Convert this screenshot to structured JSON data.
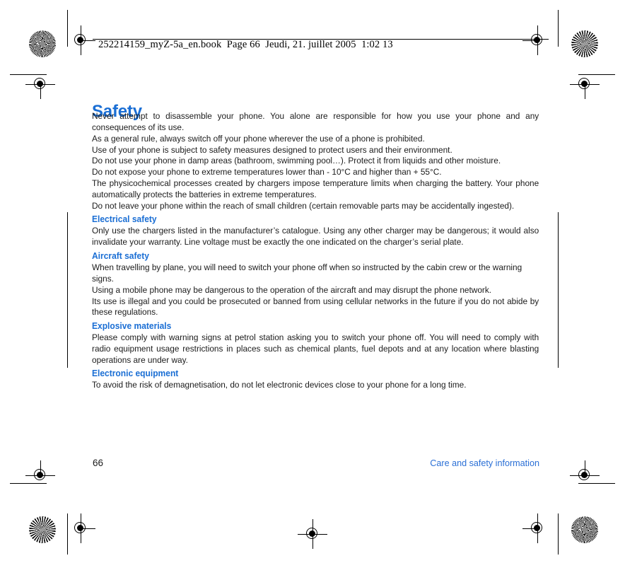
{
  "document": {
    "header_text": "252214159_myZ-5a_en.book  Page 66  Jeudi, 21. juillet 2005  1:02 13",
    "title": "Safety",
    "accent_color": "#1a6ed4",
    "body_color": "#1b1b1b"
  },
  "body": {
    "intro": [
      "Never attempt to disassemble your phone. You alone are responsible for how you use your phone and any consequences of its use.",
      "As a general rule, always switch off your phone wherever the use of a phone is prohibited.",
      "Use of your phone is subject to safety measures designed to protect users and their environment.",
      "Do not use your phone in damp areas (bathroom, swimming pool…). Protect it from liquids and other moisture.",
      "Do not expose your phone to extreme temperatures lower than - 10°C and higher than + 55°C.",
      "The physicochemical processes created by chargers impose temperature limits when charging the battery. Your phone automatically protects the batteries in extreme temperatures.",
      "Do not leave your phone within the reach of small children (certain removable parts may be accidentally ingested)."
    ],
    "sections": [
      {
        "heading": "Electrical safety",
        "paragraphs": [
          "Only use the chargers listed in the manufacturer’s catalogue. Using any other charger may be dangerous; it would also invalidate your warranty. Line voltage must be exactly the one indicated on the charger’s serial plate."
        ]
      },
      {
        "heading": "Aircraft safety",
        "paragraphs": [
          "When travelling by plane, you will need to switch your phone off when so instructed by the cabin crew or the warning signs.",
          "Using a mobile phone may be dangerous to the operation of the aircraft and may disrupt the phone network.",
          "Its use is illegal and you could be prosecuted or banned from using cellular networks in the future if you do not abide by these regulations."
        ]
      },
      {
        "heading": "Explosive materials",
        "paragraphs": [
          "Please comply with warning signs at petrol station asking you to switch your phone off. You will need to comply with radio equipment usage restrictions in places such as chemical plants, fuel depots and at any location where blasting operations are under way."
        ]
      },
      {
        "heading": "Electronic equipment",
        "paragraphs": [
          "To avoid the risk of demagnetisation, do not let electronic devices close to your phone for a long time."
        ]
      }
    ]
  },
  "footer": {
    "page_number": "66",
    "section_label": "Care and safety information"
  }
}
